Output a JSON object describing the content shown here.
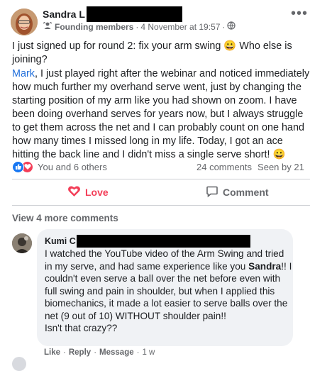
{
  "post": {
    "author_name": "Sandra L",
    "badge_label": "Founding members",
    "separator": "·",
    "timestamp": "4 November at 19:57",
    "separator2": "·",
    "privacy_icon": "globe-icon",
    "more_label": "•••",
    "paragraph1": "I just signed up for round 2: fix your arm swing 😀 Who else is joining?",
    "mention": "Mark",
    "paragraph2": ", I just played right after the webinar and noticed immediately how much further my overhand serve went, just by changing the starting position of my arm like you had shown on zoom. I have been doing overhand serves for years now, but I always struggle to get them across the net and I can probably count on one hand how many times I missed long in my life. Today, I got an ace hitting the back line and I didn't miss a single serve short! 😀"
  },
  "stats": {
    "reactions_text": "You and 6 others",
    "comments_text": "24 comments",
    "seen_text": "Seen by 21"
  },
  "actions": {
    "love_label": "Love",
    "comment_label": "Comment"
  },
  "comments": {
    "view_more_label": "View 4 more comments",
    "items": [
      {
        "author": "Kumi C",
        "text_before": "I watched the YouTube video of the Arm Swing and tried in my serve, and had same experience like you ",
        "mention": "Sandra",
        "text_after": "!! I couldn't even serve a ball over the net before even with full swing and pain in shoulder, but when I applied this biomechanics, it made a lot easier to serve balls over the net (9 out of 10) WITHOUT shoulder pain!!",
        "text_last": "Isn't that crazy??",
        "like_label": "Like",
        "reply_label": "Reply",
        "message_label": "Message",
        "sep": "·",
        "time": "1 w"
      }
    ]
  },
  "colors": {
    "accent_blue": "#216fdb",
    "love_red": "#f33e58",
    "like_blue": "#1877f2",
    "muted": "#65676b"
  }
}
